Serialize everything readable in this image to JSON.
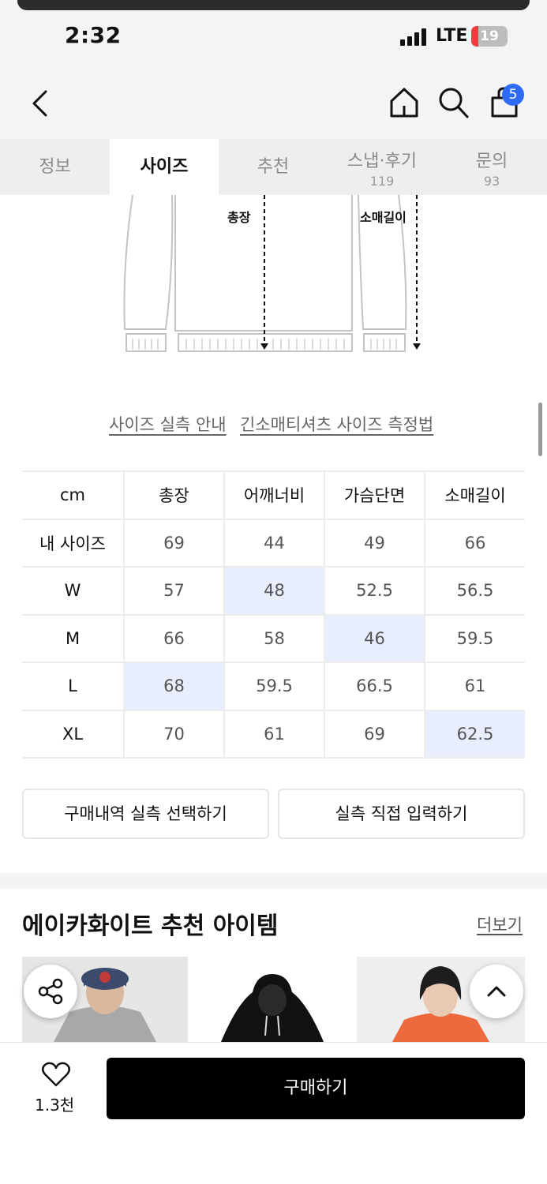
{
  "status_bar": {
    "time": "2:32",
    "network": "LTE",
    "battery": "19",
    "battery_level": 0.19
  },
  "header": {
    "cart_count": "5",
    "icons": [
      "back-icon",
      "home-icon",
      "search-icon",
      "cart-icon"
    ]
  },
  "tabs": [
    {
      "label": "정보",
      "count": ""
    },
    {
      "label": "사이즈",
      "count": ""
    },
    {
      "label": "추천",
      "count": ""
    },
    {
      "label": "스냅·후기",
      "count": "119"
    },
    {
      "label": "문의",
      "count": "93"
    }
  ],
  "diagram": {
    "label_length": "총장",
    "label_sleeve": "소매길이"
  },
  "size_links": {
    "guide": "사이즈 실측 안내",
    "method": "긴소매티셔츠 사이즈 측정법"
  },
  "size_table": {
    "headers": [
      "cm",
      "총장",
      "어깨너비",
      "가슴단면",
      "소매길이"
    ],
    "rows": [
      [
        "내 사이즈",
        "69",
        "44",
        "49",
        "66"
      ],
      [
        "W",
        "57",
        "48",
        "52.5",
        "56.5"
      ],
      [
        "M",
        "66",
        "58",
        "46",
        "59.5"
      ],
      [
        "L",
        "68",
        "59.5",
        "66.5",
        "61"
      ],
      [
        "XL",
        "70",
        "61",
        "69",
        "62.5"
      ]
    ]
  },
  "actions": {
    "select_history": "구매내역 실측 선택하기",
    "direct_input": "실측 직접 입력하기"
  },
  "recommend": {
    "title": "에이카화이트 추천 아이템",
    "more": "더보기"
  },
  "bottom": {
    "likes": "1.3천",
    "buy": "구매하기"
  },
  "colors": {
    "highlight": "#e8eefd",
    "badge": "#2f6cf6",
    "buy_button": "#000000"
  }
}
